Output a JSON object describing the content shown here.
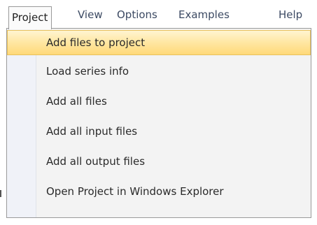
{
  "menubar": {
    "items": [
      {
        "label": "Project"
      },
      {
        "label": "View"
      },
      {
        "label": "Options"
      },
      {
        "label": "Examples"
      },
      {
        "label": "Help"
      }
    ]
  },
  "dropdown": {
    "items": [
      {
        "label": "Add files to project"
      },
      {
        "label": "Load series info"
      },
      {
        "label": "Add all files"
      },
      {
        "label": "Add all input files"
      },
      {
        "label": "Add all output files"
      },
      {
        "label": "Open Project in Windows Explorer"
      }
    ]
  },
  "colors": {
    "highlight_top": "#fff4d1",
    "highlight_bottom": "#ffd979",
    "highlight_border": "#e8c15c",
    "menu_text": "#3c4a63",
    "menu_background": "#f3f3f3"
  }
}
